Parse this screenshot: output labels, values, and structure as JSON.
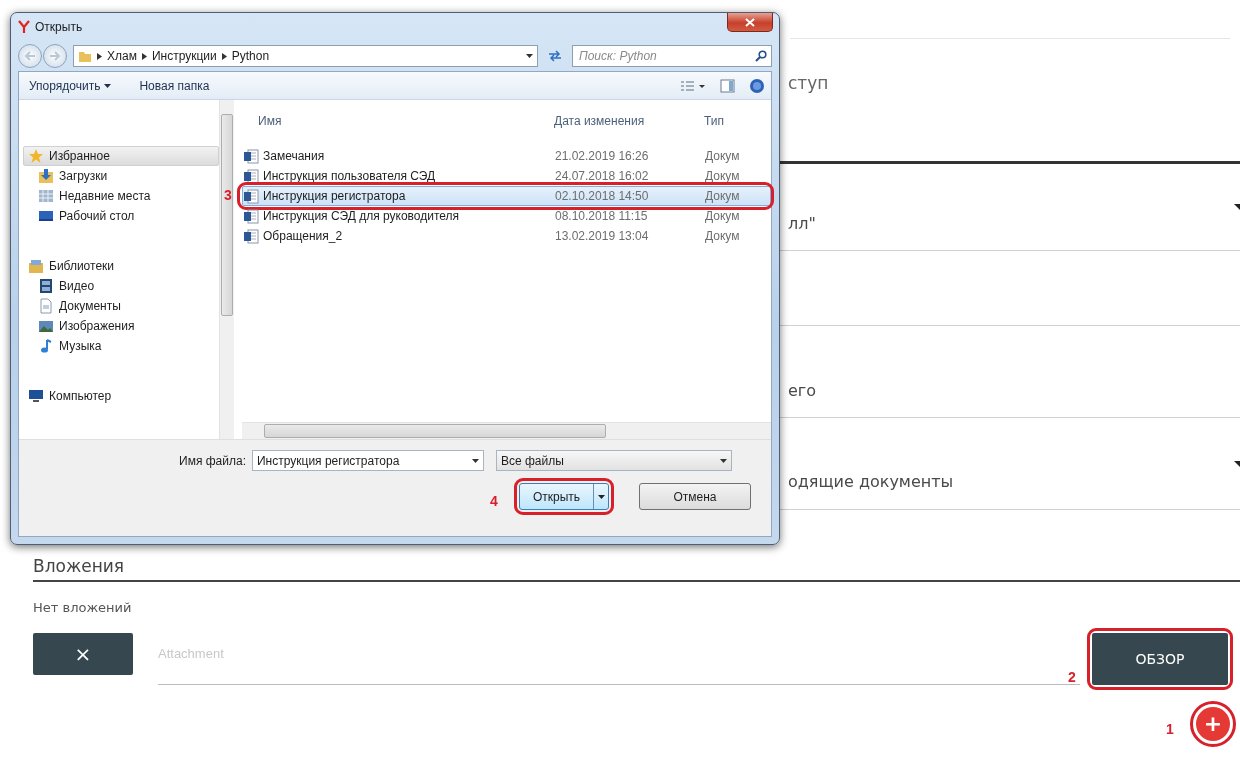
{
  "form": {
    "fields": [
      {
        "kind": "heading",
        "value": "ступ"
      },
      {
        "kind": "select",
        "value": "лл\""
      },
      {
        "kind": "empty"
      },
      {
        "kind": "text",
        "value": "его"
      },
      {
        "kind": "select",
        "value": "одящие документы"
      }
    ],
    "attachments": {
      "title": "Вложения",
      "empty_text": "Нет вложений",
      "remove_button": {
        "label": "×"
      },
      "field": {
        "placeholder": "Attachment"
      },
      "browse_button": {
        "label": "ОБЗОР",
        "annotated": true,
        "callout": "2"
      },
      "add_button": {
        "label": "+",
        "annotated": true,
        "callout": "1"
      }
    }
  },
  "dialog": {
    "title": "Открыть",
    "path": [
      "Хлам",
      "Инструкции",
      "Python"
    ],
    "search": {
      "placeholder": "Поиск: Python"
    },
    "toolbar": [
      {
        "label": "Упорядочить",
        "dropdown": true
      },
      {
        "label": "Новая папка",
        "dropdown": false
      }
    ],
    "nav": [
      {
        "label": "Избранное",
        "kind": "favorites",
        "selected": true,
        "children": [
          {
            "label": "Загрузки",
            "kind": "downloads",
            "selected": false
          },
          {
            "label": "Недавние места",
            "kind": "recent",
            "selected": false
          },
          {
            "label": "Рабочий стол",
            "kind": "desktop",
            "selected": false
          }
        ]
      },
      {
        "label": "Библиотеки",
        "kind": "libraries",
        "selected": false,
        "children": [
          {
            "label": "Видео",
            "kind": "video",
            "selected": false
          },
          {
            "label": "Документы",
            "kind": "documents",
            "selected": false
          },
          {
            "label": "Изображения",
            "kind": "images",
            "selected": false
          },
          {
            "label": "Музыка",
            "kind": "music",
            "selected": false
          }
        ]
      },
      {
        "label": "Компьютер",
        "kind": "computer",
        "selected": false
      }
    ],
    "columns": [
      "Имя",
      "Дата изменения",
      "Тип"
    ],
    "files": [
      {
        "name": "Замечания",
        "modified": "21.02.2019 16:26",
        "type": "Докум",
        "selected": false,
        "annotated": false
      },
      {
        "name": "Инструкция пользователя СЭД",
        "modified": "24.07.2018 16:02",
        "type": "Докум",
        "selected": false,
        "annotated": false
      },
      {
        "name": "Инструкция регистратора",
        "modified": "02.10.2018 14:50",
        "type": "Докум",
        "selected": true,
        "annotated": true,
        "callout": "3"
      },
      {
        "name": "Инструкция СЭД для руководителя",
        "modified": "08.10.2018 11:15",
        "type": "Докум",
        "selected": false,
        "annotated": false
      },
      {
        "name": "Обращения_2",
        "modified": "13.02.2019 13:04",
        "type": "Докум",
        "selected": false,
        "annotated": false
      }
    ],
    "file_name": {
      "label": "Имя файла:",
      "value": "Инструкция регистратора"
    },
    "file_type": {
      "value": "Все файлы"
    },
    "buttons": [
      {
        "label": "Открыть",
        "kind": "split",
        "annotated": true,
        "callout": "4"
      },
      {
        "label": "Отмена",
        "kind": "plain",
        "annotated": false
      }
    ]
  }
}
